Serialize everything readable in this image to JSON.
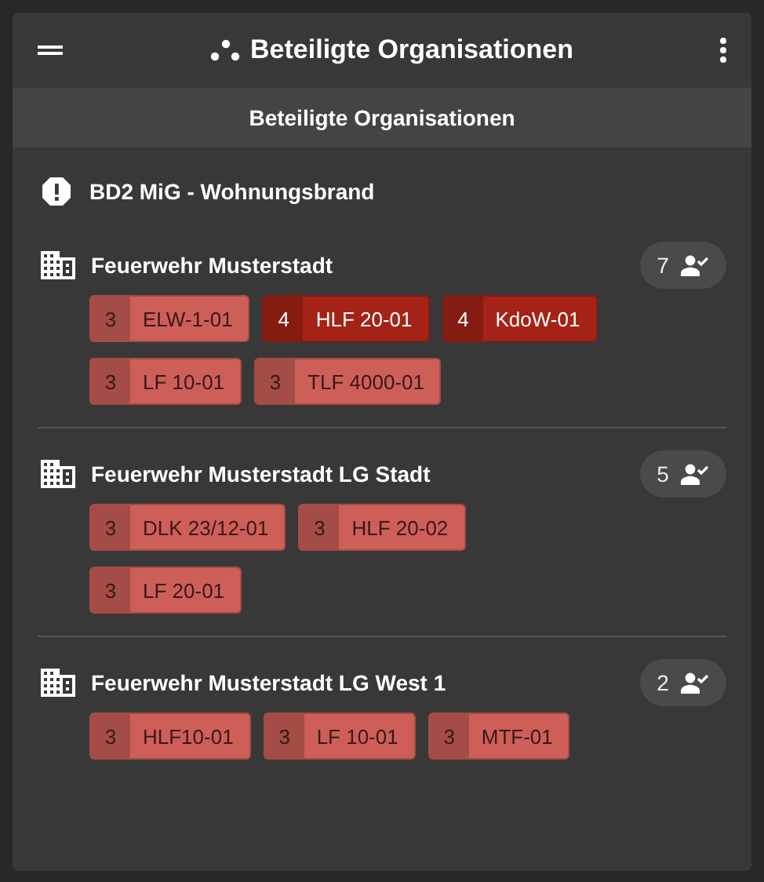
{
  "app_bar": {
    "title": "Beteiligte Organisationen"
  },
  "subheader": "Beteiligte Organisationen",
  "incident": "BD2 MiG - Wohnungsbrand",
  "organizations": [
    {
      "name": "Feuerwehr Musterstadt",
      "count": "7",
      "vehicles": [
        {
          "status": "3",
          "name": "ELW-1-01",
          "color": "#cd5f58"
        },
        {
          "status": "4",
          "name": "HLF 20-01",
          "color": "#a52316"
        },
        {
          "status": "4",
          "name": "KdoW-01",
          "color": "#a52316"
        },
        {
          "status": "3",
          "name": "LF 10-01",
          "color": "#cd5f58"
        },
        {
          "status": "3",
          "name": "TLF 4000-01",
          "color": "#cd5f58"
        }
      ]
    },
    {
      "name": "Feuerwehr Musterstadt LG Stadt",
      "count": "5",
      "vehicles": [
        {
          "status": "3",
          "name": "DLK 23/12-01",
          "color": "#cd5f58"
        },
        {
          "status": "3",
          "name": "HLF 20-02",
          "color": "#cd5f58"
        },
        {
          "status": "3",
          "name": "LF 20-01",
          "color": "#cd5f58"
        }
      ]
    },
    {
      "name": "Feuerwehr Musterstadt LG West 1",
      "count": "2",
      "vehicles": [
        {
          "status": "3",
          "name": "HLF10-01",
          "color": "#cd5f58"
        },
        {
          "status": "3",
          "name": "LF 10-01",
          "color": "#cd5f58"
        },
        {
          "status": "3",
          "name": "MTF-01",
          "color": "#cd5f58"
        }
      ]
    }
  ]
}
